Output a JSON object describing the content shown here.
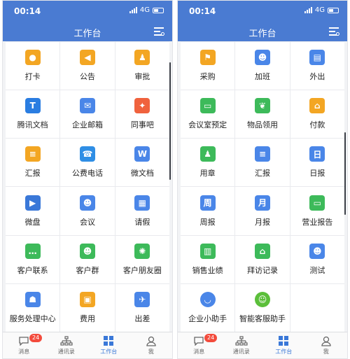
{
  "status": {
    "time": "00:14",
    "network": "4G"
  },
  "header": {
    "title": "工作台"
  },
  "tabbar": {
    "items": [
      {
        "label": "消息",
        "icon": "message-icon",
        "badge": "24"
      },
      {
        "label": "通讯录",
        "icon": "contacts-icon"
      },
      {
        "label": "工作台",
        "icon": "workbench-icon",
        "active": true
      },
      {
        "label": "我",
        "icon": "me-icon"
      }
    ]
  },
  "left_apps": [
    {
      "label": "打卡",
      "icon": "location-pin-icon",
      "color": "#f3a623"
    },
    {
      "label": "公告",
      "icon": "megaphone-icon",
      "color": "#f3a623"
    },
    {
      "label": "审批",
      "icon": "stamp-icon",
      "color": "#f3a623"
    },
    {
      "label": "腾讯文档",
      "icon": "document-icon",
      "color": "#2a7de1"
    },
    {
      "label": "企业邮箱",
      "icon": "mail-icon",
      "color": "#4a86e8"
    },
    {
      "label": "同事吧",
      "icon": "diamond-icon",
      "color": "#f0623d"
    },
    {
      "label": "汇报",
      "icon": "report-icon",
      "color": "#f3a623"
    },
    {
      "label": "公费电话",
      "icon": "phone-icon",
      "color": "#2f8ee5"
    },
    {
      "label": "微文档",
      "icon": "w-doc-icon",
      "color": "#4a86e8"
    },
    {
      "label": "微盘",
      "icon": "play-disk-icon",
      "color": "#3a78d8"
    },
    {
      "label": "会议",
      "icon": "meeting-icon",
      "color": "#4a86e8"
    },
    {
      "label": "请假",
      "icon": "calendar-icon",
      "color": "#4a86e8"
    },
    {
      "label": "客户联系",
      "icon": "chat-bubble-icon",
      "color": "#3dba5a"
    },
    {
      "label": "客户群",
      "icon": "group-icon",
      "color": "#3dba5a"
    },
    {
      "label": "客户朋友圈",
      "icon": "aperture-icon",
      "color": "#3dba5a"
    },
    {
      "label": "服务处理中心",
      "icon": "service-icon",
      "color": "#4a86e8"
    },
    {
      "label": "费用",
      "icon": "wallet-icon",
      "color": "#f3a623"
    },
    {
      "label": "出差",
      "icon": "plane-icon",
      "color": "#4a86e8"
    }
  ],
  "right_apps": [
    {
      "label": "采购",
      "icon": "cart-icon",
      "color": "#f3a623"
    },
    {
      "label": "加班",
      "icon": "overtime-icon",
      "color": "#4a86e8"
    },
    {
      "label": "外出",
      "icon": "briefcase-icon",
      "color": "#4a86e8"
    },
    {
      "label": "会议室预定",
      "icon": "meeting-room-icon",
      "color": "#3dba5a"
    },
    {
      "label": "物品领用",
      "icon": "leaf-icon",
      "color": "#3dba5a"
    },
    {
      "label": "付款",
      "icon": "payment-icon",
      "color": "#f3a623"
    },
    {
      "label": "用章",
      "icon": "stamp-icon",
      "color": "#3dba5a"
    },
    {
      "label": "汇报",
      "icon": "report-icon",
      "color": "#4a86e8"
    },
    {
      "label": "日报",
      "icon": "daily-icon",
      "color": "#4a86e8"
    },
    {
      "label": "周报",
      "icon": "weekly-icon",
      "color": "#4a86e8"
    },
    {
      "label": "月报",
      "icon": "monthly-icon",
      "color": "#4a86e8"
    },
    {
      "label": "营业报告",
      "icon": "business-report-icon",
      "color": "#3dba5a"
    },
    {
      "label": "销售业绩",
      "icon": "bar-chart-icon",
      "color": "#3dba5a"
    },
    {
      "label": "拜访记录",
      "icon": "home-icon",
      "color": "#3dba5a"
    },
    {
      "label": "测试",
      "icon": "user-card-icon",
      "color": "#4a86e8"
    },
    {
      "label": "企业小助手",
      "icon": "assistant-icon",
      "color": "#4a86e8"
    },
    {
      "label": "智能客服助手",
      "icon": "robot-icon",
      "color": "#5bbf3a"
    },
    {
      "label": "",
      "icon": "",
      "color": ""
    }
  ]
}
